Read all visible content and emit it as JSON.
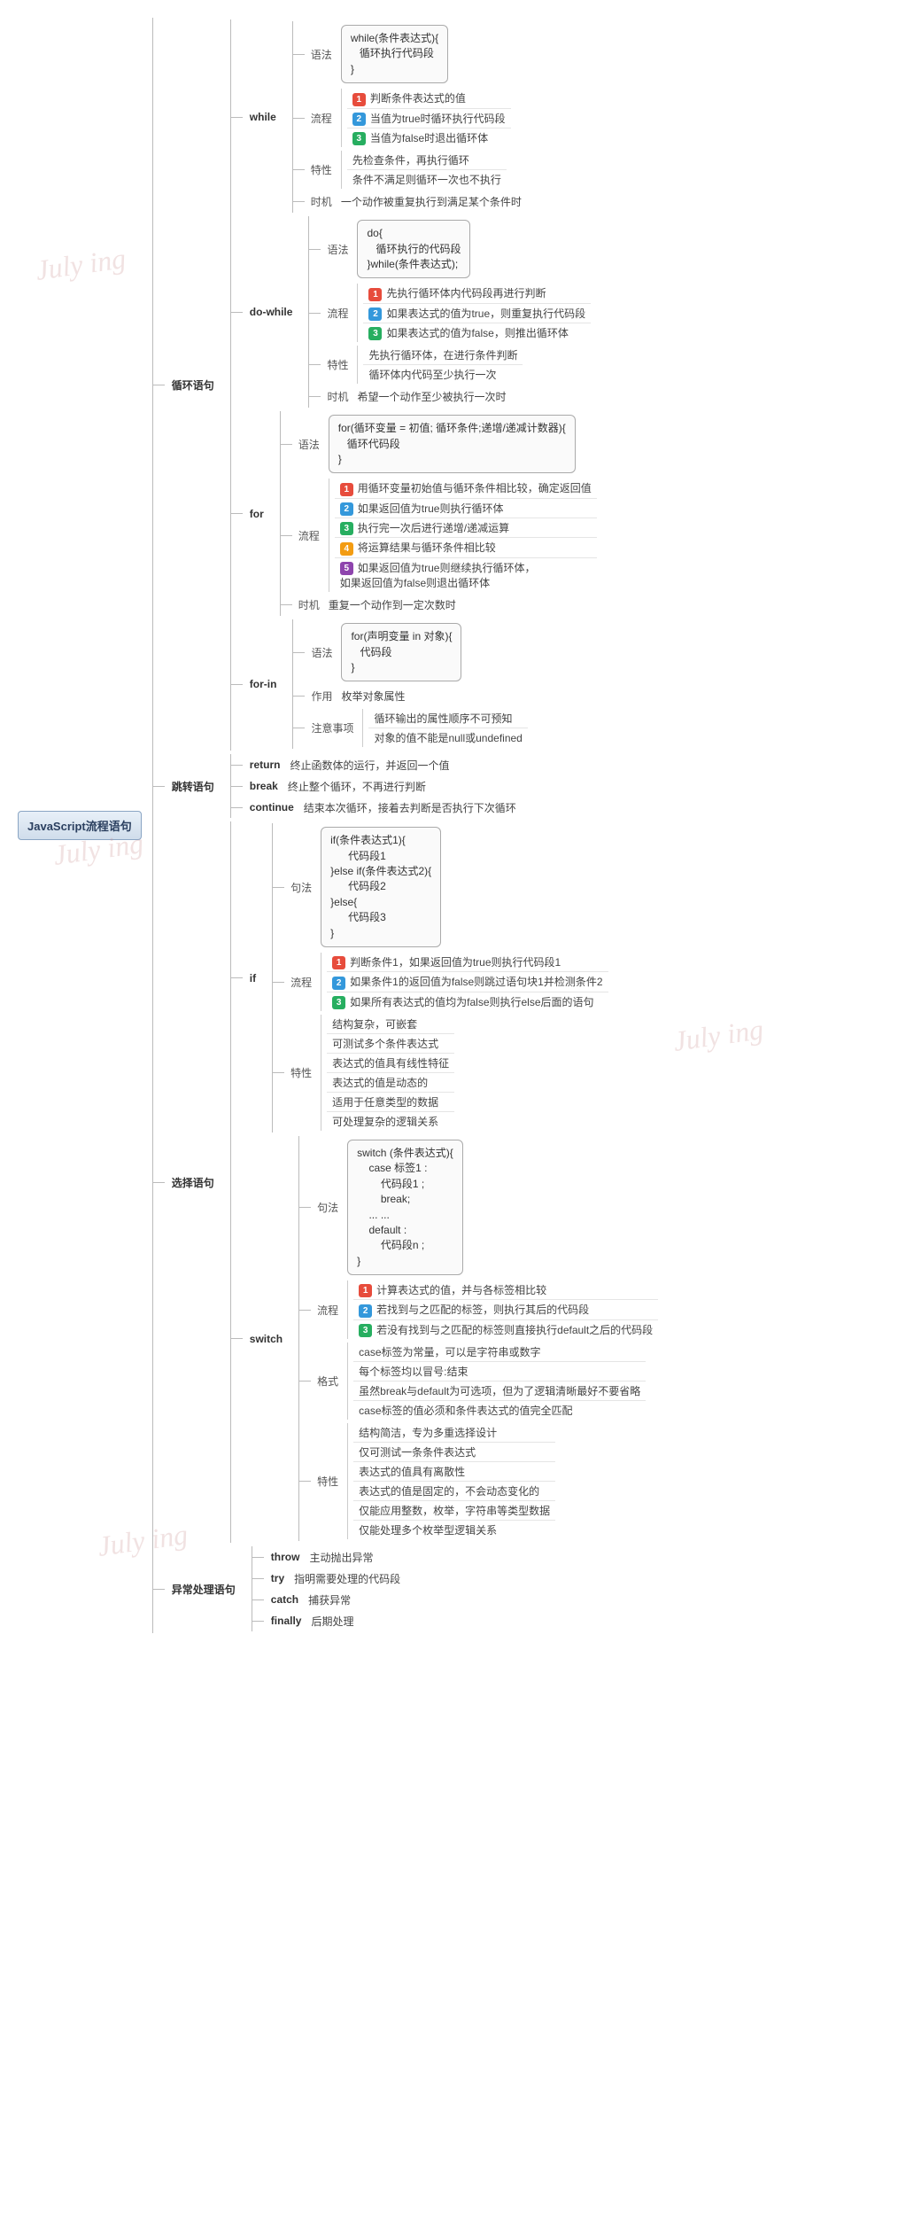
{
  "root": "JavaScript流程语句",
  "cats": {
    "loop": "循环语句",
    "jump": "跳转语句",
    "select": "选择语句",
    "except": "异常处理语句"
  },
  "labels": {
    "syntax": "语法",
    "syntax2": "句法",
    "flow": "流程",
    "trait": "特性",
    "timing": "时机",
    "use": "作用",
    "note": "注意事项",
    "format": "格式"
  },
  "while": {
    "name": "while",
    "code": "while(条件表达式){\n   循环执行代码段\n}",
    "flow": [
      "判断条件表达式的值",
      "当值为true时循环执行代码段",
      "当值为false时退出循环体"
    ],
    "trait": [
      "先检查条件，再执行循环",
      "条件不满足则循环一次也不执行"
    ],
    "timing": "一个动作被重复执行到满足某个条件时"
  },
  "dowhile": {
    "name": "do-while",
    "code": "do{\n   循环执行的代码段\n}while(条件表达式);",
    "flow": [
      "先执行循环体内代码段再进行判断",
      "如果表达式的值为true，则重复执行代码段",
      "如果表达式的值为false，则推出循环体"
    ],
    "trait": [
      "先执行循环体，在进行条件判断",
      "循环体内代码至少执行一次"
    ],
    "timing": "希望一个动作至少被执行一次时"
  },
  "for": {
    "name": "for",
    "code": "for(循环变量 = 初值; 循环条件;递增/递减计数器){\n   循环代码段\n}",
    "flow": [
      "用循环变量初始值与循环条件相比较，确定返回值",
      "如果返回值为true则执行循环体",
      "执行完一次后进行递增/递减运算",
      "将运算结果与循环条件相比较",
      "如果返回值为true则继续执行循环体，\n如果返回值为false则退出循环体"
    ],
    "timing": "重复一个动作到一定次数时"
  },
  "forin": {
    "name": "for-in",
    "code": "for(声明变量 in 对象){\n   代码段\n}",
    "use": "枚举对象属性",
    "note": [
      "循环输出的属性顺序不可预知",
      "对象的值不能是null或undefined"
    ]
  },
  "jump": {
    "return": {
      "name": "return",
      "desc": "终止函数体的运行，并返回一个值"
    },
    "break": {
      "name": "break",
      "desc": "终止整个循环，不再进行判断"
    },
    "continue": {
      "name": "continue",
      "desc": "结束本次循环，接着去判断是否执行下次循环"
    }
  },
  "if": {
    "name": "if",
    "code": "if(条件表达式1){\n      代码段1\n}else if(条件表达式2){\n      代码段2\n}else{\n      代码段3\n}",
    "flow": [
      "判断条件1，如果返回值为true则执行代码段1",
      "如果条件1的返回值为false则跳过语句块1并检测条件2",
      "如果所有表达式的值均为false则执行else后面的语句"
    ],
    "trait": [
      "结构复杂，可嵌套",
      "可测试多个条件表达式",
      "表达式的值具有线性特征",
      "表达式的值是动态的",
      "适用于任意类型的数据",
      "可处理复杂的逻辑关系"
    ]
  },
  "switch": {
    "name": "switch",
    "code": "switch (条件表达式){\n    case 标签1 :\n        代码段1 ;\n        break;\n    ... ...\n    default :\n        代码段n ;\n}",
    "flow": [
      "计算表达式的值，并与各标签相比较",
      "若找到与之匹配的标签，则执行其后的代码段",
      "若没有找到与之匹配的标签则直接执行default之后的代码段"
    ],
    "format": [
      "case标签为常量，可以是字符串或数字",
      "每个标签均以冒号:结束",
      "虽然break与default为可选项，但为了逻辑清晰最好不要省略",
      "case标签的值必须和条件表达式的值完全匹配"
    ],
    "trait": [
      "结构简洁，专为多重选择设计",
      "仅可测试一条条件表达式",
      "表达式的值具有离散性",
      "表达式的值是固定的，不会动态变化的",
      "仅能应用整数，枚举，字符串等类型数据",
      "仅能处理多个枚举型逻辑关系"
    ]
  },
  "except": {
    "throw": {
      "name": "throw",
      "desc": "主动抛出异常"
    },
    "try": {
      "name": "try",
      "desc": "指明需要处理的代码段"
    },
    "catch": {
      "name": "catch",
      "desc": "捕获异常"
    },
    "finally": {
      "name": "finally",
      "desc": "后期处理"
    }
  },
  "watermark": "July ing"
}
